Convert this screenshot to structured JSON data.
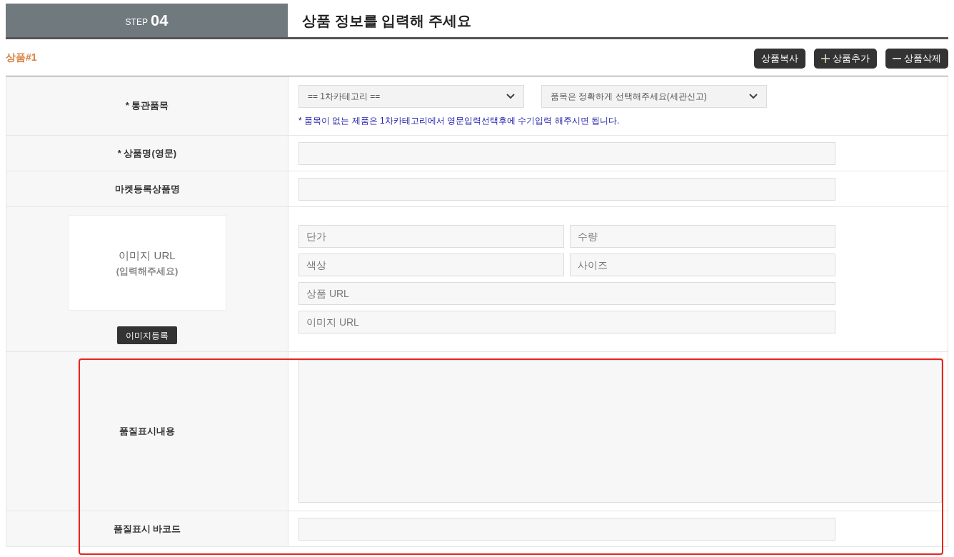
{
  "step": {
    "label": "STEP",
    "number": "04"
  },
  "title": "상품 정보를 입력해 주세요",
  "product_heading": "상품#1",
  "buttons": [
    {
      "label": "상품복사",
      "kind": "copy"
    },
    {
      "label": "상품추가",
      "kind": "add"
    },
    {
      "label": "상품삭제",
      "kind": "remove"
    }
  ],
  "rows": [
    {
      "kind": "category",
      "label": "* 통관품목",
      "selects": [
        "== 1차카테고리 ==",
        "품목은 정확하게 선택해주세요(세관신고)"
      ],
      "note": "* 품목이 없는 제품은 1차카테고리에서 영문입력선택후에 수기입력 해주시면 됩니다."
    },
    {
      "kind": "input",
      "label": "* 상품명(영문)"
    },
    {
      "kind": "input",
      "label": "마켓등록상품명"
    },
    {
      "kind": "image",
      "preview_title": "이미지 URL",
      "preview_hint": "(입력해주세요)",
      "button": "이미지등록",
      "fields": [
        {
          "kind": "half",
          "placeholder": "단가"
        },
        {
          "kind": "half",
          "placeholder": "수량"
        },
        {
          "kind": "half",
          "placeholder": "색상"
        },
        {
          "kind": "half",
          "placeholder": "사이즈"
        },
        {
          "kind": "full",
          "placeholder": "상품 URL"
        },
        {
          "kind": "full",
          "placeholder": "이미지 URL"
        }
      ]
    },
    {
      "kind": "textarea",
      "label": "품질표시내용"
    },
    {
      "kind": "input",
      "label": "품질표시 바코드"
    }
  ]
}
